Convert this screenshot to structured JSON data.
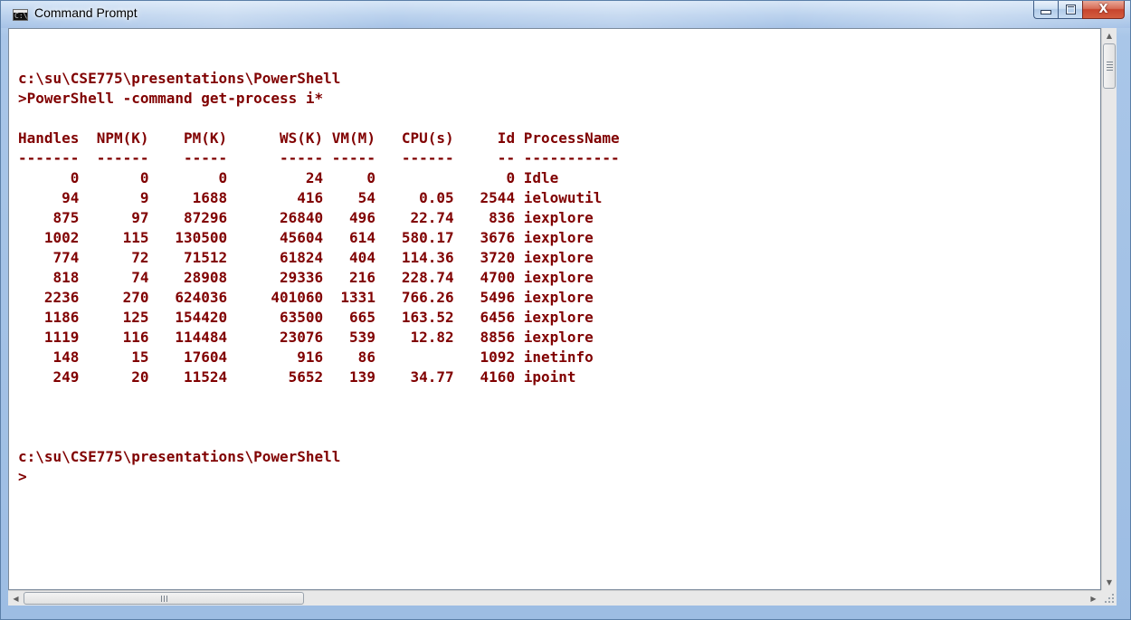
{
  "window": {
    "title": "Command Prompt",
    "icon_text": "C:\\",
    "caption": {
      "minimize_icon": "minimize-icon",
      "maximize_icon": "maximize-icon",
      "close_glyph": "X"
    }
  },
  "colors": {
    "console_text": "#800000",
    "console_background": "#ffffff"
  },
  "console": {
    "lines": [
      "",
      "c:\\su\\CSE775\\presentations\\PowerShell",
      ">PowerShell -command get-process i*",
      "",
      "Handles  NPM(K)    PM(K)      WS(K) VM(M)   CPU(s)     Id ProcessName",
      "-------  ------    -----      ----- -----   ------     -- -----------",
      "      0       0        0         24     0               0 Idle",
      "     94       9     1688        416    54     0.05   2544 ielowutil",
      "    875      97    87296      26840   496    22.74    836 iexplore",
      "   1002     115   130500      45604   614   580.17   3676 iexplore",
      "    774      72    71512      61824   404   114.36   3720 iexplore",
      "    818      74    28908      29336   216   228.74   4700 iexplore",
      "   2236     270   624036     401060  1331   766.26   5496 iexplore",
      "   1186     125   154420      63500   665   163.52   6456 iexplore",
      "   1119     116   114484      23076   539    12.82   8856 iexplore",
      "    148      15    17604        916    86            1092 inetinfo",
      "    249      20    11524       5652   139    34.77   4160 ipoint",
      "",
      "",
      "",
      "c:\\su\\CSE775\\presentations\\PowerShell",
      ">"
    ]
  },
  "scrollbars": {
    "vertical": {
      "up_icon": "▲",
      "down_icon": "▼"
    },
    "horizontal": {
      "left_icon": "◀",
      "right_icon": "▶"
    }
  }
}
